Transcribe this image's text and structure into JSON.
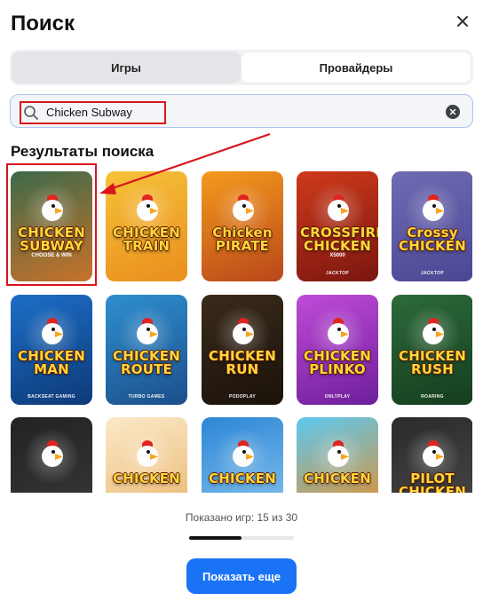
{
  "dialog": {
    "title": "Поиск",
    "close_icon": "close-icon"
  },
  "tabs": [
    {
      "label": "Игры",
      "active": true
    },
    {
      "label": "Провайдеры",
      "active": false
    }
  ],
  "search": {
    "value": "Chicken Subway",
    "search_icon": "magnifier-icon",
    "clear_icon": "clear-icon"
  },
  "results": {
    "title": "Результаты поиска",
    "games": [
      {
        "title": "CHICKEN SUBWAY",
        "subtitle": "CHOOSE & WIN",
        "provider": "",
        "bg": "#3d6a4a",
        "bg2": "#c8722a",
        "selected": true
      },
      {
        "title": "CHICKEN TRAIN",
        "subtitle": "",
        "provider": "",
        "bg": "#f6c23a",
        "bg2": "#e98e1d",
        "selected": false
      },
      {
        "title": "Chicken PIRATE",
        "subtitle": "",
        "provider": "",
        "bg": "#f59a1d",
        "bg2": "#b8471a",
        "selected": false
      },
      {
        "title": "CROSSFIRE CHICKEN",
        "subtitle": "x5000",
        "provider": "JACKTOP",
        "bg": "#cf3a1a",
        "bg2": "#7a1610",
        "selected": false
      },
      {
        "title": "Crossy CHICKEN",
        "subtitle": "",
        "provider": "JACKTOP",
        "bg": "#6f6bb3",
        "bg2": "#4a4693",
        "selected": false
      },
      {
        "title": "CHICKEN MAN",
        "subtitle": "",
        "provider": "BACKSEAT GAMING",
        "bg": "#1d6ec7",
        "bg2": "#0d3a78",
        "selected": false
      },
      {
        "title": "CHICKEN ROUTE",
        "subtitle": "",
        "provider": "TURBO GAMES",
        "bg": "#2f8fd0",
        "bg2": "#1b4f8a",
        "selected": false
      },
      {
        "title": "CHICKEN RUN",
        "subtitle": "",
        "provider": "PODOPLAY",
        "bg": "#3a2a1b",
        "bg2": "#1a120a",
        "selected": false
      },
      {
        "title": "CHICKEN PLINKO",
        "subtitle": "",
        "provider": "ONLYPLAY",
        "bg": "#c04bd8",
        "bg2": "#6d1f9a",
        "selected": false
      },
      {
        "title": "CHICKEN RUSH",
        "subtitle": "",
        "provider": "ROARING",
        "bg": "#2d6b3a",
        "bg2": "#143d1e",
        "selected": false
      },
      {
        "title": "",
        "subtitle": "",
        "provider": "",
        "bg": "#222",
        "bg2": "#3a3a3a",
        "selected": false
      },
      {
        "title": "CHICKEN",
        "subtitle": "",
        "provider": "",
        "bg": "#fbe9c8",
        "bg2": "#e9b46a",
        "selected": false
      },
      {
        "title": "CHICKEN",
        "subtitle": "",
        "provider": "",
        "bg": "#2c86d6",
        "bg2": "#8cc7ee",
        "selected": false
      },
      {
        "title": "CHICKEN",
        "subtitle": "",
        "provider": "",
        "bg": "#5cc8f0",
        "bg2": "#f08a1d",
        "selected": false
      },
      {
        "title": "PILOT CHICKEN",
        "subtitle": "",
        "provider": "",
        "bg": "#2b2b2b",
        "bg2": "#4a4a4a",
        "selected": false
      }
    ]
  },
  "pagination": {
    "shown_text": "Показано игр: 15 из 30",
    "progress_fraction": 0.5,
    "more_label": "Показать еще"
  },
  "colors": {
    "accent": "#1a73f5",
    "highlight": "#d8161e"
  }
}
